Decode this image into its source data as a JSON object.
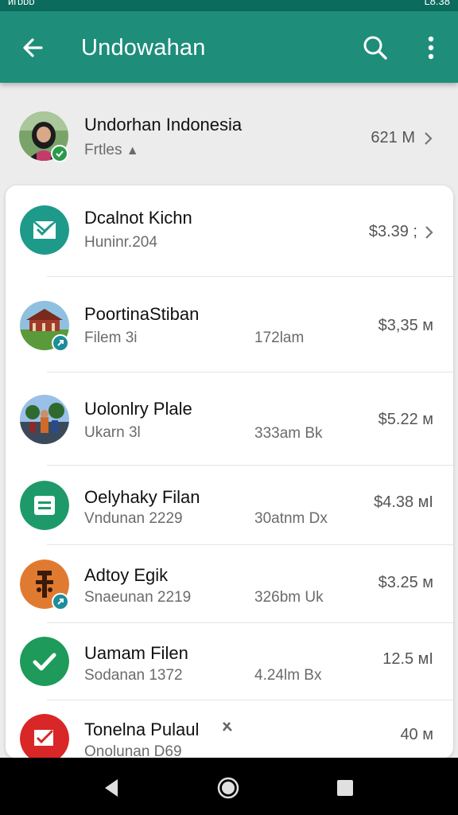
{
  "status_bar": {
    "left": "ᴎᴦᴅᴅᴅ",
    "right": "L8.38"
  },
  "app_bar": {
    "title": "Undowahan",
    "back_icon": "arrow-back-icon",
    "search_icon": "search-icon",
    "menu_icon": "more-vert-icon"
  },
  "header": {
    "name": "Undorhan Indonesia",
    "subtitle": "Frtles",
    "size": "621 M",
    "badge_icon": "check-badge-icon"
  },
  "items": [
    {
      "name": "Dcalnot Kichn",
      "sub": "Huninr.204",
      "middle": "",
      "amount": "$3.39 ;",
      "icon": "mail-check-icon",
      "color": "#1e9a8a",
      "chevron": true
    },
    {
      "name": "PoortinaStiban",
      "sub": "Filem 3i",
      "middle": "172lam",
      "amount": "$3,35 ᴍ",
      "icon": "house-photo-icon",
      "color": "#6a9a5a",
      "chevron": false
    },
    {
      "name": "Uolonlry Plale",
      "sub": "Ukarn 3l",
      "middle": "333am Bk",
      "amount": "$5.22 ᴍ",
      "icon": "people-photo-icon",
      "color": "#3d6a8a",
      "chevron": false
    },
    {
      "name": "Oelyhaky Filan",
      "sub": "Vndunan 2229",
      "middle": "30atnm Dx",
      "amount": "$4.38 ᴍI",
      "icon": "document-icon",
      "color": "#1e9a6a",
      "chevron": false
    },
    {
      "name": "Adtoy Egik",
      "sub": "Snaeunan 2219",
      "middle": "326bm Uk",
      "amount": "$3.25 ᴍ",
      "icon": "totem-icon",
      "color": "#e07a30",
      "chevron": false
    },
    {
      "name": "Uamam Filen",
      "sub": "Sodanan 1372",
      "middle": "4.24lm Bx",
      "amount": "12.5 ᴍI",
      "icon": "checkmark-icon",
      "color": "#1e9a5a",
      "chevron": false
    },
    {
      "name": "Tonelna Pulaul",
      "sub": "Onolunan D69",
      "middle": "",
      "amount": "40 ᴍ",
      "icon": "ballot-check-icon",
      "color": "#d92626",
      "chevron": false
    }
  ],
  "nav": {
    "back": "nav-back-icon",
    "home": "nav-home-icon",
    "recents": "nav-recents-icon"
  }
}
